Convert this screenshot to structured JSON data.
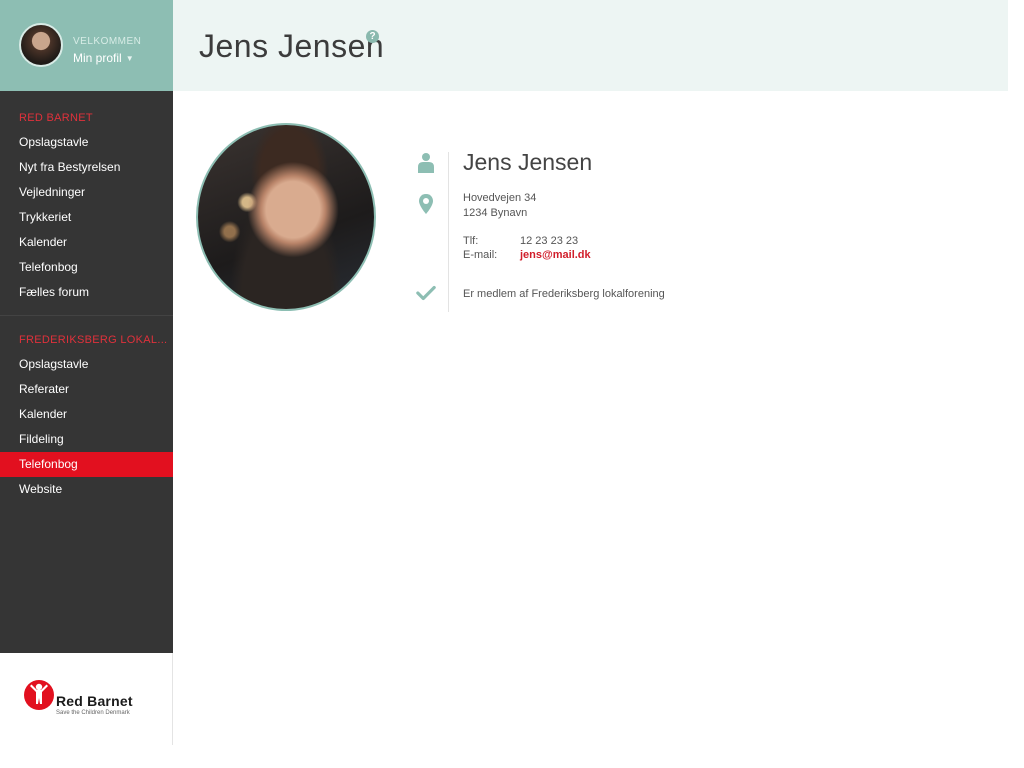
{
  "sidebar": {
    "welcome": "VELKOMMEN",
    "profile_link": "Min profil",
    "groups": [
      {
        "title": "RED BARNET",
        "items": [
          "Opslagstavle",
          "Nyt fra Bestyrelsen",
          "Vejledninger",
          "Trykkeriet",
          "Kalender",
          "Telefonbog",
          "Fælles forum"
        ]
      },
      {
        "title": "FREDERIKSBERG LOKAL...",
        "items": [
          "Opslagstavle",
          "Referater",
          "Kalender",
          "Fildeling",
          "Telefonbog",
          "Website"
        ],
        "active_item": "Telefonbog"
      }
    ],
    "brand": {
      "name": "Red Barnet",
      "tagline": "Save the Children Denmark"
    }
  },
  "header": {
    "title": "Jens Jensen",
    "help_icon": "question-circle-icon"
  },
  "profile": {
    "name": "Jens Jensen",
    "address_line1": "Hovedvejen 34",
    "address_line2": "1234 Bynavn",
    "phone_label": "Tlf:",
    "phone": "12 23 23 23",
    "email_label": "E-mail:",
    "email": "jens@mail.dk",
    "membership": "Er medlem af Frederiksberg lokalforening",
    "icons": [
      "person-icon",
      "map-pin-icon",
      "check-icon"
    ]
  },
  "colors": {
    "accent_teal": "#8dbeb3",
    "header_bg": "#edf5f3",
    "sidebar_bg": "#353535",
    "active_red": "#e2101f",
    "link_red": "#d11d2a"
  }
}
